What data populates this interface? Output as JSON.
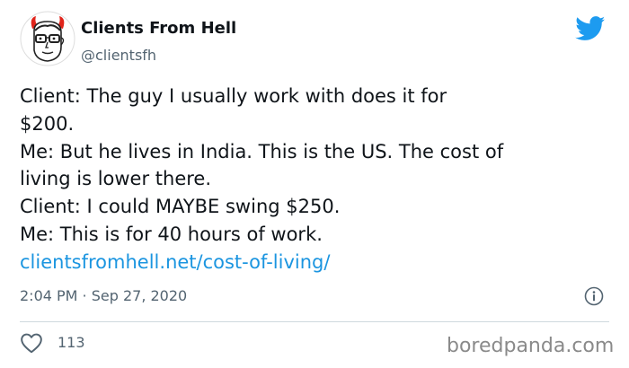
{
  "account": {
    "name": "Clients From Hell",
    "handle": "@clientsfh"
  },
  "tweet": {
    "lines": [
      "Client: The guy I usually work with does it for",
      "$200.",
      "Me: But he lives in India. This is the US. The cost of",
      "living is lower there.",
      "Client: I could MAYBE swing $250.",
      "Me: This is for 40 hours of work."
    ],
    "link": "clientsfromhell.net/cost-of-living/",
    "time": "2:04 PM · Sep 27, 2020",
    "likes": "113"
  },
  "icons": {
    "avatar": "devil-face-avatar",
    "brand": "twitter-bird-icon",
    "info": "info-icon",
    "like": "heart-icon"
  },
  "colors": {
    "link": "#1b95e0",
    "brand": "#1d9bf0",
    "secondary_text": "#536471"
  },
  "watermark": "boredpanda.com"
}
